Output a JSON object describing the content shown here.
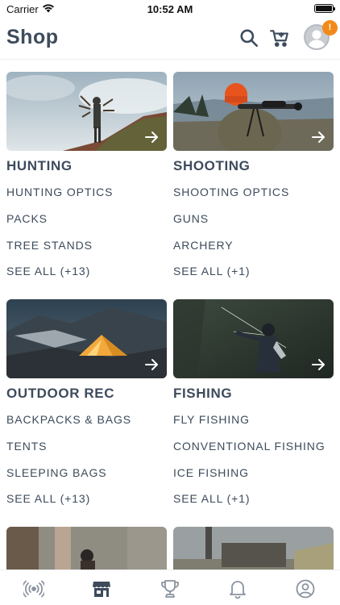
{
  "status_bar": {
    "carrier": "Carrier",
    "time": "10:52 AM"
  },
  "header": {
    "title": "Shop",
    "notification_badge": "!"
  },
  "categories": [
    {
      "title": "HUNTING",
      "links": [
        "HUNTING OPTICS",
        "PACKS",
        "TREE STANDS"
      ],
      "see_all": "SEE ALL (+13)"
    },
    {
      "title": "SHOOTING",
      "links": [
        "SHOOTING OPTICS",
        "GUNS",
        "ARCHERY"
      ],
      "see_all": "SEE ALL (+1)"
    },
    {
      "title": "OUTDOOR REC",
      "links": [
        "BACKPACKS & BAGS",
        "TENTS",
        "SLEEPING BAGS"
      ],
      "see_all": "SEE ALL (+13)"
    },
    {
      "title": "FISHING",
      "links": [
        "FLY FISHING",
        "CONVENTIONAL FISHING",
        "ICE FISHING"
      ],
      "see_all": "SEE ALL (+1)"
    }
  ],
  "tab_bar": {
    "tabs": [
      {
        "icon": "broadcast-icon",
        "active": false
      },
      {
        "icon": "store-icon",
        "active": true
      },
      {
        "icon": "trophy-icon",
        "active": false
      },
      {
        "icon": "bell-icon",
        "active": false
      },
      {
        "icon": "profile-icon",
        "active": false
      }
    ]
  },
  "colors": {
    "text": "#3d4b5c",
    "badge": "#f28a1b",
    "tab_inactive": "#8a93a0"
  }
}
